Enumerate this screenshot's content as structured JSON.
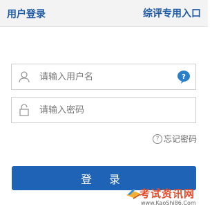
{
  "header": {
    "title": "用户登录",
    "alt_link": "综评专用入口"
  },
  "form": {
    "username_placeholder": "请输入用户名",
    "password_placeholder": "请输入密码",
    "forgot_password": "忘记密码",
    "login_button": "登 录"
  },
  "watermark": {
    "text": "考试资讯网",
    "url": "www.KaoShi86.Com"
  },
  "colors": {
    "accent": "#1f63b6",
    "title": "#1f5aa6"
  }
}
